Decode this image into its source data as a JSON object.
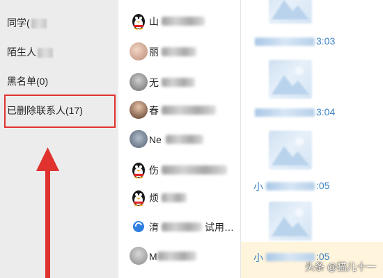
{
  "groups": [
    {
      "label": "同学(",
      "tail": true
    },
    {
      "label": "陌生人",
      "tail": true
    },
    {
      "label": "黑名单(0)",
      "tail": false
    },
    {
      "label": "已删除联系人(17)",
      "tail": false
    }
  ],
  "contacts": [
    {
      "name": "山",
      "avatar": "qq-penguin-icon"
    },
    {
      "name": "丽",
      "avatar": "photo-avatar"
    },
    {
      "name": "无",
      "avatar": "photo-avatar"
    },
    {
      "name": "春",
      "avatar": "photo-avatar"
    },
    {
      "name": "Ne",
      "avatar": "photo-avatar"
    },
    {
      "name": "伤",
      "avatar": "qq-penguin-icon"
    },
    {
      "name": "烦",
      "avatar": "qq-penguin-icon"
    },
    {
      "name": "淯",
      "suffix": "试用…",
      "avatar": "blue-app-icon"
    },
    {
      "name": "M",
      "avatar": "photo-avatar"
    }
  ],
  "messages": [
    {
      "prefix": "",
      "time": "3:03"
    },
    {
      "prefix": "",
      "time": "3:04"
    },
    {
      "prefix": "小",
      "time": ":05"
    },
    {
      "prefix": "小",
      "time": ":05"
    }
  ],
  "watermark": "头条 @猫儿十一",
  "colors": {
    "highlight": "#e0322e",
    "arrow": "#e0322e",
    "time": "#3b82c4",
    "selected": "#fff4dc"
  }
}
